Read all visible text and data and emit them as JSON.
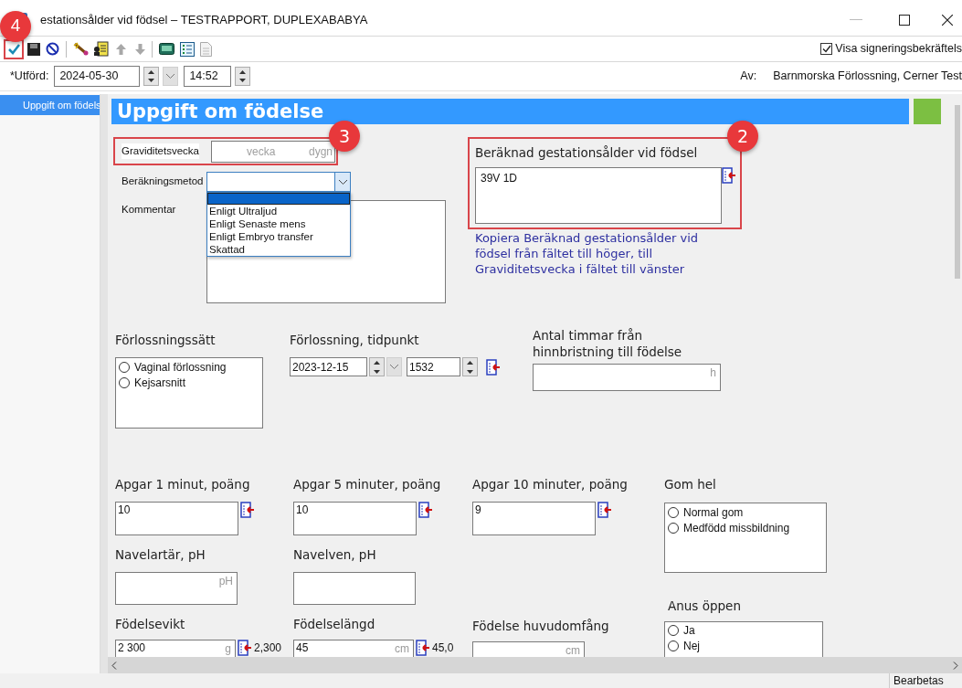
{
  "window": {
    "title": "estationsålder vid födsel – TESTRAPPORT, DUPLEXABABYA"
  },
  "toolbar": {
    "show_confirmation": {
      "label": "Visa signeringsbekräftels",
      "checked": true
    }
  },
  "performed": {
    "label": "*Utförd:",
    "date": "2024-05-30",
    "time": "14:52",
    "by_label": "Av:",
    "by": "Barnmorska Förlossning, Cerner Test"
  },
  "sidebar": {
    "items": [
      {
        "label": "Uppgift om födels",
        "selected": true
      }
    ]
  },
  "section_title": "Uppgift om födelse",
  "gestation": {
    "label": "Graviditetsvecka",
    "week_placeholder": "vecka",
    "day_placeholder": "dygn"
  },
  "method": {
    "label": "Beräkningsmetod",
    "empty_option_selected": true,
    "options": [
      {
        "label": "Enligt Ultraljud",
        "selected": false
      },
      {
        "label": "Enligt Senaste mens",
        "selected": false
      },
      {
        "label": "Enligt Embryo transfer",
        "selected": false
      },
      {
        "label": "Skattad",
        "selected": false
      }
    ]
  },
  "comment": {
    "label": "Kommentar"
  },
  "calculated": {
    "label": "Beräknad gestationsålder vid födsel",
    "value": "39V 1D",
    "hint": "Kopiera Beräknad gestationsålder vid födsel från fältet till höger, till Graviditetsvecka i fältet till vänster"
  },
  "delivery_mode": {
    "label": "Förlossningssätt",
    "options": [
      {
        "label": "Vaginal förlossning",
        "selected": false
      },
      {
        "label": "Kejsarsnitt",
        "selected": false
      }
    ]
  },
  "delivery_time": {
    "label": "Förlossning, tidpunkt",
    "date": "2023-12-15",
    "time": "1532"
  },
  "rupture_hours": {
    "label": "Antal timmar från hinnbristning till födelse",
    "unit": "h"
  },
  "apgar": [
    {
      "label": "Apgar 1 minut, poäng",
      "value": "10"
    },
    {
      "label": "Apgar 5 minuter, poäng",
      "value": "10"
    },
    {
      "label": "Apgar 10 minuter, poäng",
      "value": "9"
    }
  ],
  "palate": {
    "label": "Gom hel",
    "options": [
      {
        "label": "Normal gom",
        "selected": false
      },
      {
        "label": "Medfödd missbildning",
        "selected": false
      }
    ]
  },
  "ph": [
    {
      "label": "Navelartär, pH",
      "unit": "pH"
    },
    {
      "label": "Navelven, pH"
    }
  ],
  "anus": {
    "label": "Anus öppen",
    "options": [
      {
        "label": "Ja",
        "selected": false
      },
      {
        "label": "Nej",
        "selected": false
      }
    ]
  },
  "measures": [
    {
      "label": "Födelsevikt",
      "value": "2 300",
      "unit": "g",
      "converted": "2,300"
    },
    {
      "label": "Födelselängd",
      "value": "45",
      "unit": "cm",
      "converted": "45,0"
    },
    {
      "label": "Födelse huvudomfång",
      "unit": "cm"
    }
  ],
  "status_bar": {
    "text": "Bearbetas"
  },
  "callouts": [
    {
      "number": "4"
    },
    {
      "number": "3"
    },
    {
      "number": "2"
    }
  ]
}
